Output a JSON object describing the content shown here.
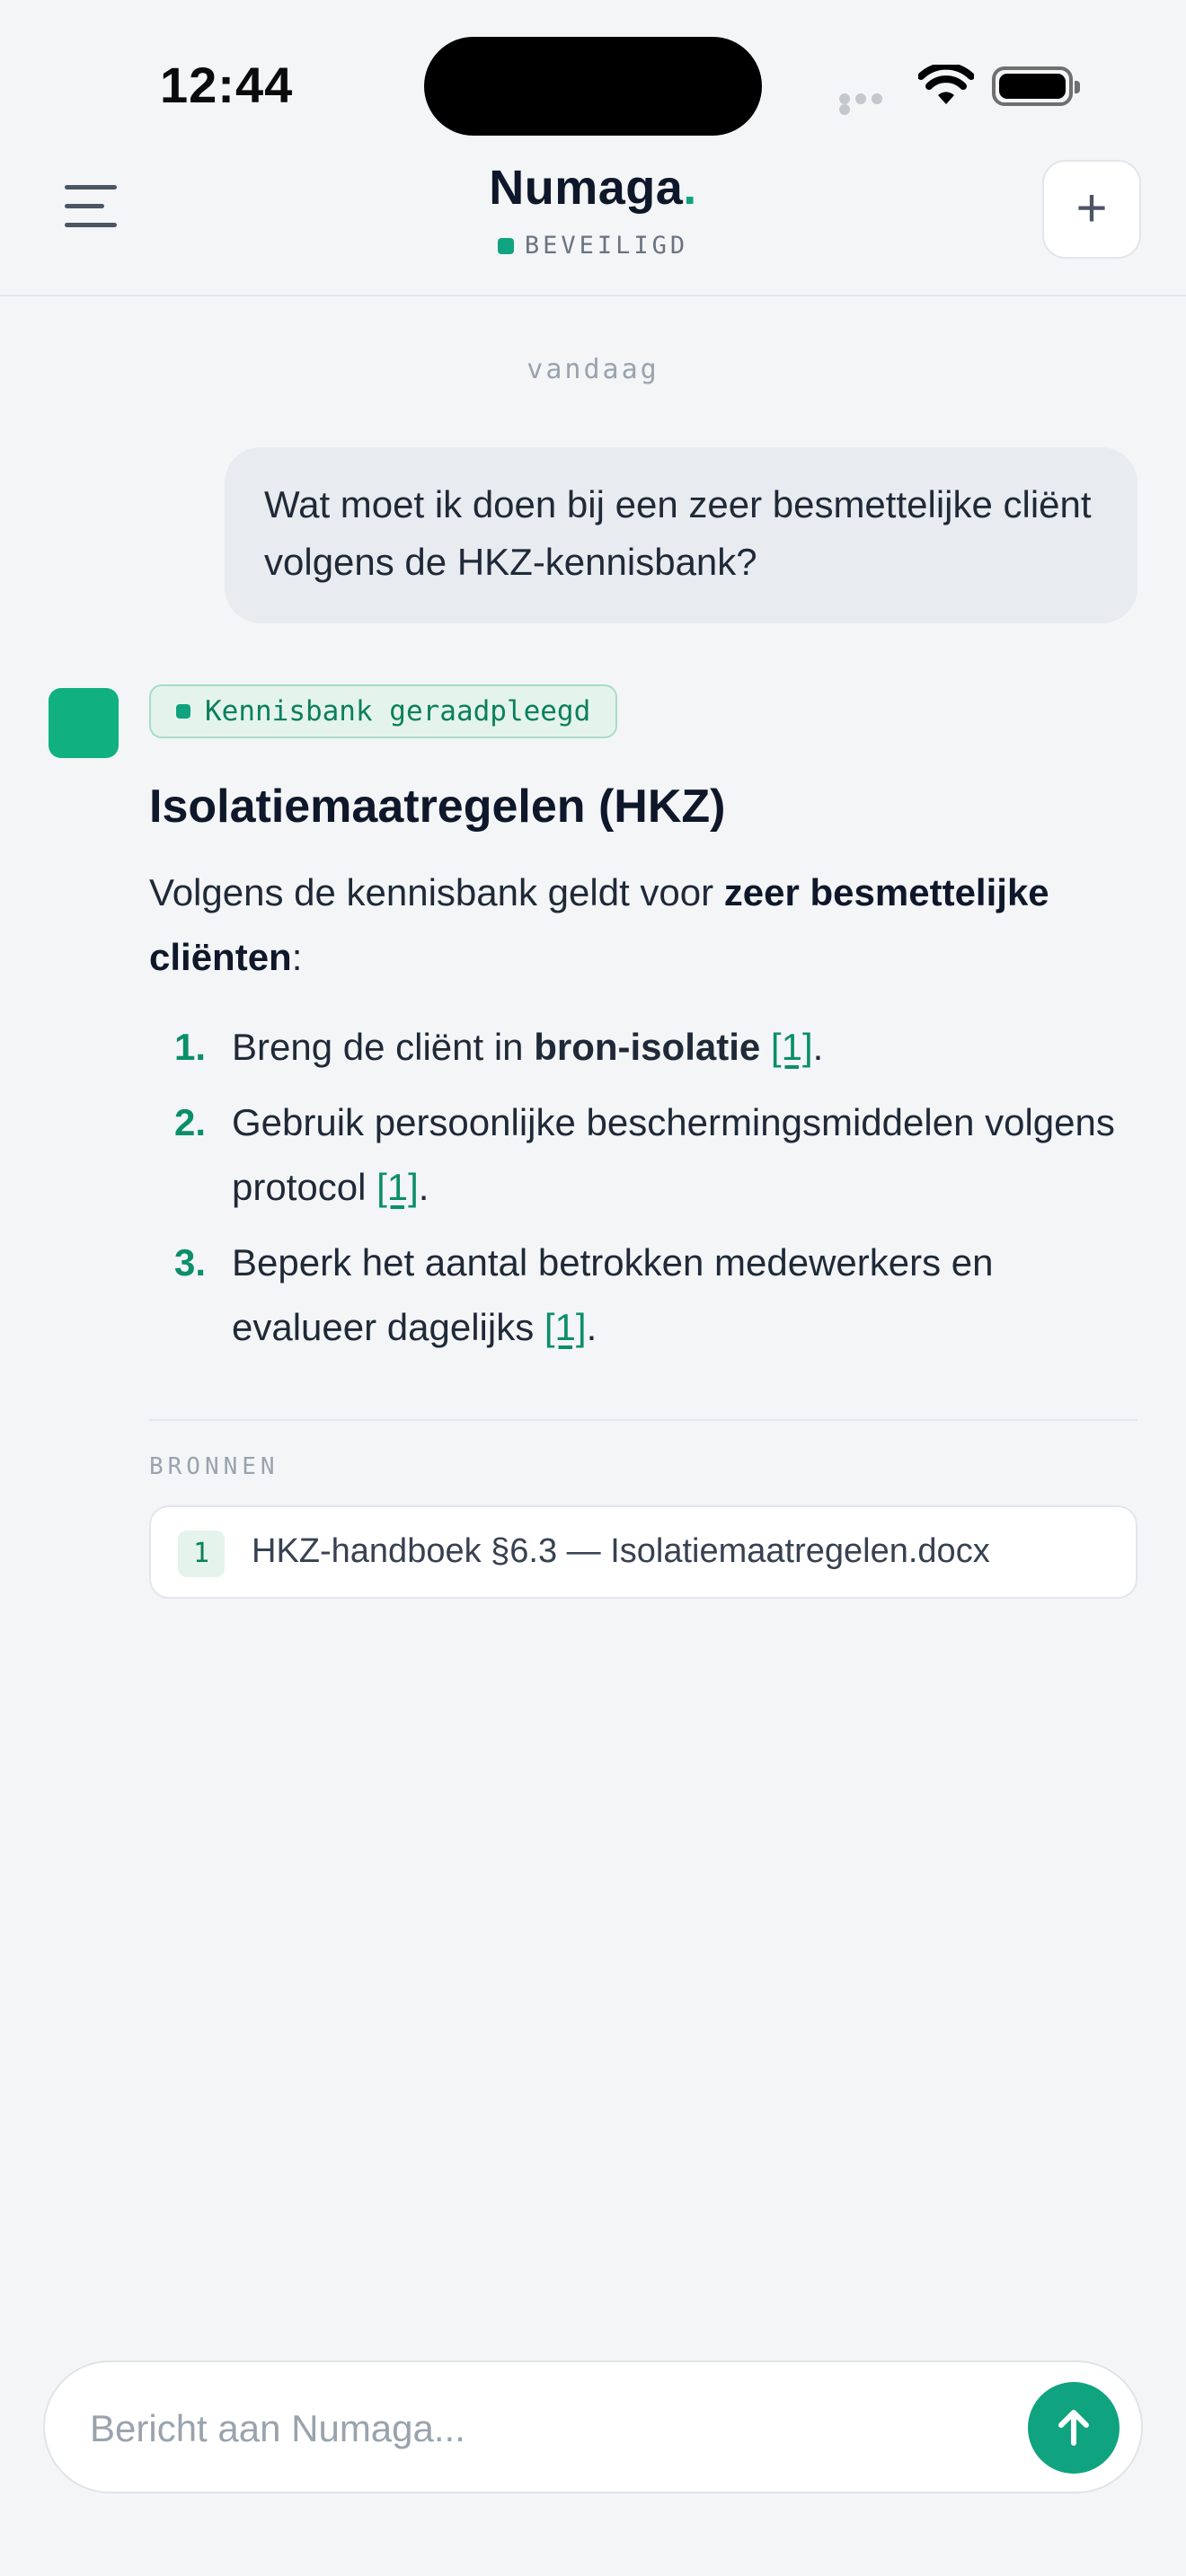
{
  "status_bar": {
    "time": "12:44"
  },
  "header": {
    "brand_name": "Numaga",
    "brand_dot": ".",
    "status_label": "BEVEILIGD",
    "new_chat_glyph": "+",
    "icons": [
      "menu-icon",
      "plus-icon"
    ]
  },
  "chat": {
    "day_label": "vandaag",
    "user_message": "Wat moet ik doen bij een zeer besmettelijke cliënt volgens de HKZ-kennisbank?",
    "assistant": {
      "kb_badge": "Kennisbank geraadpleegd",
      "title": "Isolatiemaatregelen (HKZ)",
      "intro_prefix": "Volgens de kennisbank geldt voor ",
      "intro_bold": "zeer besmettelijke cliënten",
      "intro_suffix": ":",
      "steps": [
        {
          "num": "1.",
          "prefix": "Breng de cliënt in ",
          "bold": "bron-isolatie",
          "text": "",
          "cite": "[1]",
          "end": "."
        },
        {
          "num": "2.",
          "prefix": "",
          "bold": "",
          "text": "Gebruik persoonlijke beschermingsmiddelen volgens protocol ",
          "cite": "[1]",
          "end": "."
        },
        {
          "num": "3.",
          "prefix": "",
          "bold": "",
          "text": "Beperk het aantal betrokken medewerkers en evalueer dagelijks ",
          "cite": "[1]",
          "end": "."
        }
      ],
      "sources_label": "BRONNEN",
      "sources": [
        {
          "num": "1",
          "title": "HKZ-handboek §6.3 — Isolatiemaatregelen.docx"
        }
      ]
    }
  },
  "composer": {
    "placeholder": "Bericht aan Numaga..."
  },
  "colors": {
    "accent": "#10a37f",
    "background": "#f3f5f7",
    "user_bubble": "#e8ebef"
  }
}
